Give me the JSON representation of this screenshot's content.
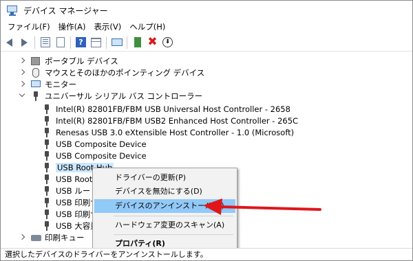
{
  "window": {
    "title": "デバイス マネージャー",
    "title_icon": "device-manager-icon"
  },
  "menu": [
    "ファイル(F)",
    "操作(A)",
    "表示(V)",
    "ヘルプ(H)"
  ],
  "toolbar": {
    "icons": [
      "back-arrow-icon",
      "forward-arrow-icon",
      "properties-icon",
      "document-icon",
      "help-icon",
      "table-view-icon",
      "scan-hardware-icon",
      "add-driver-icon",
      "uninstall-x-icon",
      "update-driver-icon"
    ],
    "help_glyph": "?",
    "remove_glyph": "✖",
    "down_glyph": "⬇"
  },
  "tree": {
    "categories": [
      {
        "label": "ポータブル デバイス",
        "state": "collapsed",
        "icon": "portable-device-icon"
      },
      {
        "label": "マウスとそのほかのポインティング デバイス",
        "state": "collapsed",
        "icon": "mouse-icon"
      },
      {
        "label": "モニター",
        "state": "collapsed",
        "icon": "monitor-icon"
      },
      {
        "label": "ユニバーサル シリアル バス コントローラー",
        "state": "expanded",
        "icon": "usb-icon"
      }
    ],
    "usb_children": [
      "Intel(R) 82801FB/FBM USB Universal Host Controller - 2658",
      "Intel(R) 82801FB/FBM USB2 Enhanced Host Controller - 265C",
      "Renesas USB 3.0 eXtensible Host Controller - 1.0 (Microsoft)",
      "USB Composite Device",
      "USB Composite Device",
      "USB Root Hub",
      "USB Root H",
      "USB ルート ハ",
      "USB 印刷サ",
      "USB 印刷サ",
      "USB 大容量"
    ],
    "selected_index": 5,
    "last_category": {
      "label": "印刷キュー",
      "state": "collapsed",
      "icon": "printer-icon"
    }
  },
  "context_menu": {
    "items": [
      {
        "label": "ドライバーの更新(P)",
        "highlighted": false,
        "bold": false
      },
      {
        "label": "デバイスを無効にする(D)",
        "highlighted": false,
        "bold": false
      },
      {
        "label": "デバイスのアンインストール(U)",
        "highlighted": true,
        "bold": false
      },
      {
        "label": "ハードウェア変更のスキャン(A)",
        "highlighted": false,
        "bold": false
      },
      {
        "label": "プロパティ(R)",
        "highlighted": false,
        "bold": true
      }
    ]
  },
  "annotation": {
    "type": "arrow",
    "color": "#e0161a",
    "points_to": "context-menu-uninstall-device"
  },
  "status": "選択したデバイスのドライバーをアンインストールします。",
  "colors": {
    "highlight": "#91c9f7",
    "selection": "#cce8ff",
    "accent": "#2e63b8"
  }
}
